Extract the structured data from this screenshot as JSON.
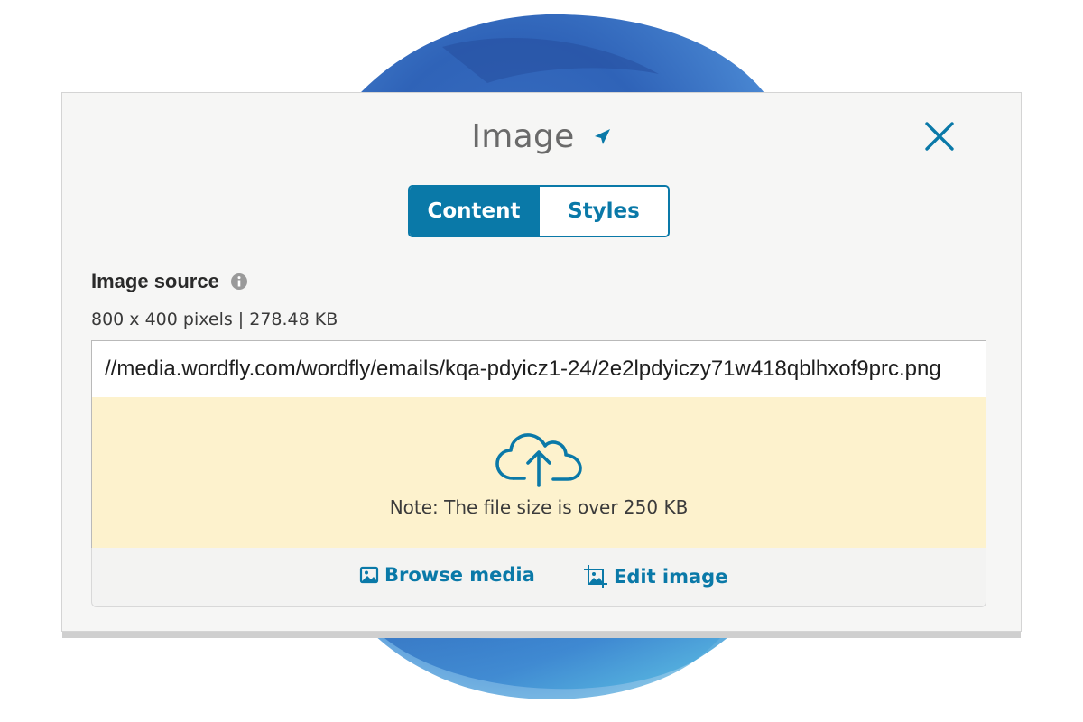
{
  "panel": {
    "title": "Image",
    "title_icon": "pin-arrow-icon",
    "close_icon": "close-icon"
  },
  "tabs": [
    {
      "label": "Content",
      "active": true
    },
    {
      "label": "Styles",
      "active": false
    }
  ],
  "image_source": {
    "label": "Image source",
    "info_icon": "info-icon",
    "meta": "800 x 400 pixels | 278.48 KB",
    "url_value": "//media.wordfly.com/wordfly/emails/kqa-pdyicz1-24/2e2lpdyiczy71w418qblhxof9prc.png"
  },
  "dropzone": {
    "icon": "cloud-upload-icon",
    "note": "Note: The file size is over 250 KB"
  },
  "actions": {
    "browse_label": "Browse media",
    "browse_icon": "image-icon",
    "edit_label": "Edit image",
    "edit_icon": "crop-image-icon"
  },
  "colors": {
    "accent": "#0a79a8",
    "warning_bg": "#fdf2cd",
    "panel_bg": "#f6f6f5"
  }
}
